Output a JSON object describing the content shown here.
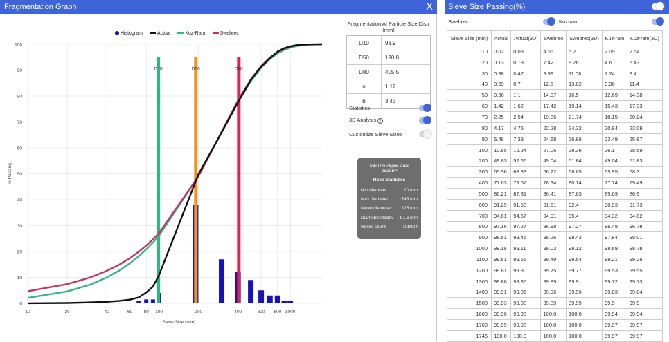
{
  "graph": {
    "title": "Fragmentation Graph",
    "close_glyph": "X",
    "legend": [
      {
        "label": "Histogram",
        "color": "#1414b8",
        "kind": "dot"
      },
      {
        "label": "Actual",
        "color": "#111111",
        "kind": "line"
      },
      {
        "label": "Kuz-Ram",
        "color": "#2fb886",
        "kind": "line"
      },
      {
        "label": "Swebrec",
        "color": "#c8325a",
        "kind": "line"
      }
    ]
  },
  "chart_data": {
    "type": "line",
    "xscale": "log",
    "xlabel": "Sieve Size (mm)",
    "ylabel": "% Passing",
    "xlim": [
      10,
      1745
    ],
    "ylim": [
      0,
      100
    ],
    "x_ticks": [
      "10",
      "20",
      "40",
      "60",
      "80",
      "100",
      "200",
      "400",
      "600",
      "800",
      "1000"
    ],
    "y_ticks": [
      "0",
      "10",
      "20",
      "30",
      "40",
      "50",
      "60",
      "70",
      "80",
      "90",
      "100"
    ],
    "grid": true,
    "markers": [
      {
        "label": "D10",
        "x": 98.9,
        "color": "#2fb886"
      },
      {
        "label": "D50",
        "x": 190.8,
        "color": "#f39217"
      },
      {
        "label": "D80",
        "x": 405.5,
        "color": "#e3204f"
      }
    ],
    "histogram": {
      "color": "#1414b8",
      "bars": [
        {
          "x": 70,
          "y": 1
        },
        {
          "x": 80,
          "y": 1.5
        },
        {
          "x": 90,
          "y": 1.5
        },
        {
          "x": 100,
          "y": 4
        },
        {
          "x": 190,
          "y": 38
        },
        {
          "x": 300,
          "y": 17
        },
        {
          "x": 400,
          "y": 12
        },
        {
          "x": 500,
          "y": 9
        },
        {
          "x": 600,
          "y": 5
        },
        {
          "x": 700,
          "y": 3
        },
        {
          "x": 800,
          "y": 3
        },
        {
          "x": 900,
          "y": 1
        },
        {
          "x": 1000,
          "y": 1
        }
      ]
    },
    "series": [
      {
        "name": "Actual",
        "color": "#111111",
        "x": [
          10,
          20,
          30,
          40,
          50,
          60,
          70,
          80,
          90,
          100,
          200,
          300,
          400,
          500,
          600,
          700,
          800,
          900,
          1000,
          1100,
          1200,
          1300,
          1400,
          1500,
          1600,
          1700,
          1745
        ],
        "y": [
          0.02,
          0.13,
          0.38,
          0.59,
          0.96,
          1.42,
          2.25,
          4.17,
          6.48,
          10.85,
          49.83,
          65.96,
          77.63,
          86.21,
          91.29,
          94.61,
          97.16,
          98.51,
          99.18,
          99.61,
          99.81,
          99.88,
          99.91,
          99.93,
          99.96,
          99.99,
          100.0
        ]
      },
      {
        "name": "Kuz-Ram",
        "color": "#2fb886",
        "x": [
          10,
          20,
          30,
          40,
          50,
          60,
          70,
          80,
          90,
          100,
          200,
          300,
          400,
          500,
          600,
          700,
          800,
          900,
          1000,
          1100,
          1200,
          1300,
          1400,
          1500,
          1600,
          1700,
          1745
        ],
        "y": [
          2.09,
          4.6,
          7.24,
          9.96,
          12.69,
          15.43,
          18.15,
          20.84,
          23.49,
          26.1,
          49.04,
          65.95,
          77.74,
          85.69,
          90.93,
          94.32,
          96.48,
          97.84,
          98.69,
          99.21,
          99.53,
          99.72,
          99.83,
          99.9,
          99.94,
          99.97,
          99.97
        ]
      },
      {
        "name": "Swebrec",
        "color": "#c8325a",
        "x": [
          10,
          20,
          30,
          40,
          50,
          60,
          70,
          80,
          90,
          100,
          200,
          300,
          400,
          500,
          600,
          700,
          800,
          900,
          1000,
          1100,
          1200,
          1300,
          1400,
          1500,
          1600,
          1700,
          1745
        ],
        "y": [
          4.65,
          7.42,
          9.99,
          12.5,
          14.97,
          17.42,
          19.86,
          22.28,
          24.68,
          27.06,
          49.04,
          66.22,
          78.34,
          86.41,
          91.61,
          94.91,
          96.98,
          98.26,
          99.03,
          99.49,
          99.75,
          99.89,
          99.96,
          99.99,
          100.0,
          100.0,
          100.0
        ]
      }
    ]
  },
  "distribution": {
    "title": "Fragmentation AI Particle Size Distr (mm)",
    "rows": [
      {
        "k": "D10",
        "v": "98.9"
      },
      {
        "k": "D50",
        "v": "190.8"
      },
      {
        "k": "D80",
        "v": "405.5"
      },
      {
        "k": "n",
        "v": "1.12"
      },
      {
        "k": "b",
        "v": "3.43"
      }
    ]
  },
  "options": {
    "statistics": {
      "label": "Statistics",
      "on": true
    },
    "analysis3d": {
      "label": "3D Analysis",
      "on": true,
      "info": "i"
    },
    "customize": {
      "label": "Customize Sieve Sizes",
      "on": false
    }
  },
  "stats": {
    "total": "Total muckpile area 2533m²",
    "heading": "Rock Statistics",
    "rows": [
      {
        "k": "Min diameter",
        "v": "10 mm"
      },
      {
        "k": "Max diameter",
        "v": "1745 mm"
      },
      {
        "k": "Mean diameter",
        "v": "125 mm"
      },
      {
        "k": "Diameter stddev",
        "v": "91.6 mm"
      },
      {
        "k": "Rocks count",
        "v": "108824"
      }
    ]
  },
  "sieve": {
    "title": "Sieve Size Passing(%)",
    "toggle_swebrec": "Swebrec",
    "toggle_kuzram": "Kuz-ram",
    "headers": [
      "Sieve Size (mm)",
      "Actual",
      "Actual(3D)",
      "Swebrec",
      "Swebrec(3D)",
      "Kuz-ram",
      "Kuz-ram(3D)"
    ],
    "rows": [
      [
        "10",
        "0.02",
        "0.03",
        "4.65",
        "5.2",
        "2.09",
        "2.54"
      ],
      [
        "20",
        "0.13",
        "0.18",
        "7.42",
        "8.26",
        "4.6",
        "5.43"
      ],
      [
        "30",
        "0.38",
        "0.47",
        "9.99",
        "11.08",
        "7.24",
        "8.4"
      ],
      [
        "40",
        "0.59",
        "0.7",
        "12.5",
        "13.82",
        "9.96",
        "11.4"
      ],
      [
        "50",
        "0.96",
        "1.1",
        "14.97",
        "16.5",
        "12.69",
        "14.38"
      ],
      [
        "60",
        "1.42",
        "1.62",
        "17.42",
        "19.14",
        "15.43",
        "17.33"
      ],
      [
        "70",
        "2.25",
        "2.54",
        "19.86",
        "21.74",
        "18.15",
        "20.24"
      ],
      [
        "80",
        "4.17",
        "4.75",
        "22.28",
        "24.32",
        "20.84",
        "23.09"
      ],
      [
        "90",
        "6.48",
        "7.33",
        "24.68",
        "26.86",
        "23.49",
        "25.87"
      ],
      [
        "100",
        "10.85",
        "12.24",
        "27.06",
        "29.36",
        "26.1",
        "28.59"
      ],
      [
        "200",
        "49.83",
        "52.66",
        "49.04",
        "51.84",
        "49.04",
        "51.83"
      ],
      [
        "300",
        "65.96",
        "68.83",
        "66.22",
        "68.65",
        "65.95",
        "68.3"
      ],
      [
        "400",
        "77.63",
        "79.57",
        "78.34",
        "80.14",
        "77.74",
        "79.49"
      ],
      [
        "500",
        "86.21",
        "87.31",
        "86.41",
        "87.63",
        "85.69",
        "86.9"
      ],
      [
        "600",
        "91.29",
        "91.58",
        "91.61",
        "92.4",
        "90.93",
        "91.73"
      ],
      [
        "700",
        "94.61",
        "94.67",
        "94.91",
        "95.4",
        "94.32",
        "94.82"
      ],
      [
        "800",
        "97.16",
        "97.27",
        "96.98",
        "97.27",
        "96.48",
        "96.78"
      ],
      [
        "900",
        "98.51",
        "98.45",
        "98.26",
        "98.43",
        "97.84",
        "98.01"
      ],
      [
        "1000",
        "99.18",
        "99.11",
        "99.03",
        "99.12",
        "98.69",
        "98.78"
      ],
      [
        "1100",
        "99.61",
        "99.65",
        "99.49",
        "99.54",
        "99.21",
        "99.26"
      ],
      [
        "1200",
        "99.81",
        "99.8",
        "99.75",
        "99.77",
        "99.53",
        "99.55"
      ],
      [
        "1300",
        "99.88",
        "99.85",
        "99.89",
        "99.9",
        "99.72",
        "99.73"
      ],
      [
        "1400",
        "99.91",
        "99.86",
        "99.96",
        "99.96",
        "99.83",
        "99.84"
      ],
      [
        "1500",
        "99.93",
        "99.88",
        "99.99",
        "99.99",
        "99.9",
        "99.9"
      ],
      [
        "1600",
        "99.96",
        "99.93",
        "100.0",
        "100.0",
        "99.94",
        "99.94"
      ],
      [
        "1700",
        "99.99",
        "99.98",
        "100.0",
        "100.0",
        "99.97",
        "99.97"
      ],
      [
        "1745",
        "100.0",
        "100.0",
        "100.0",
        "100.0",
        "99.97",
        "99.97"
      ]
    ]
  }
}
